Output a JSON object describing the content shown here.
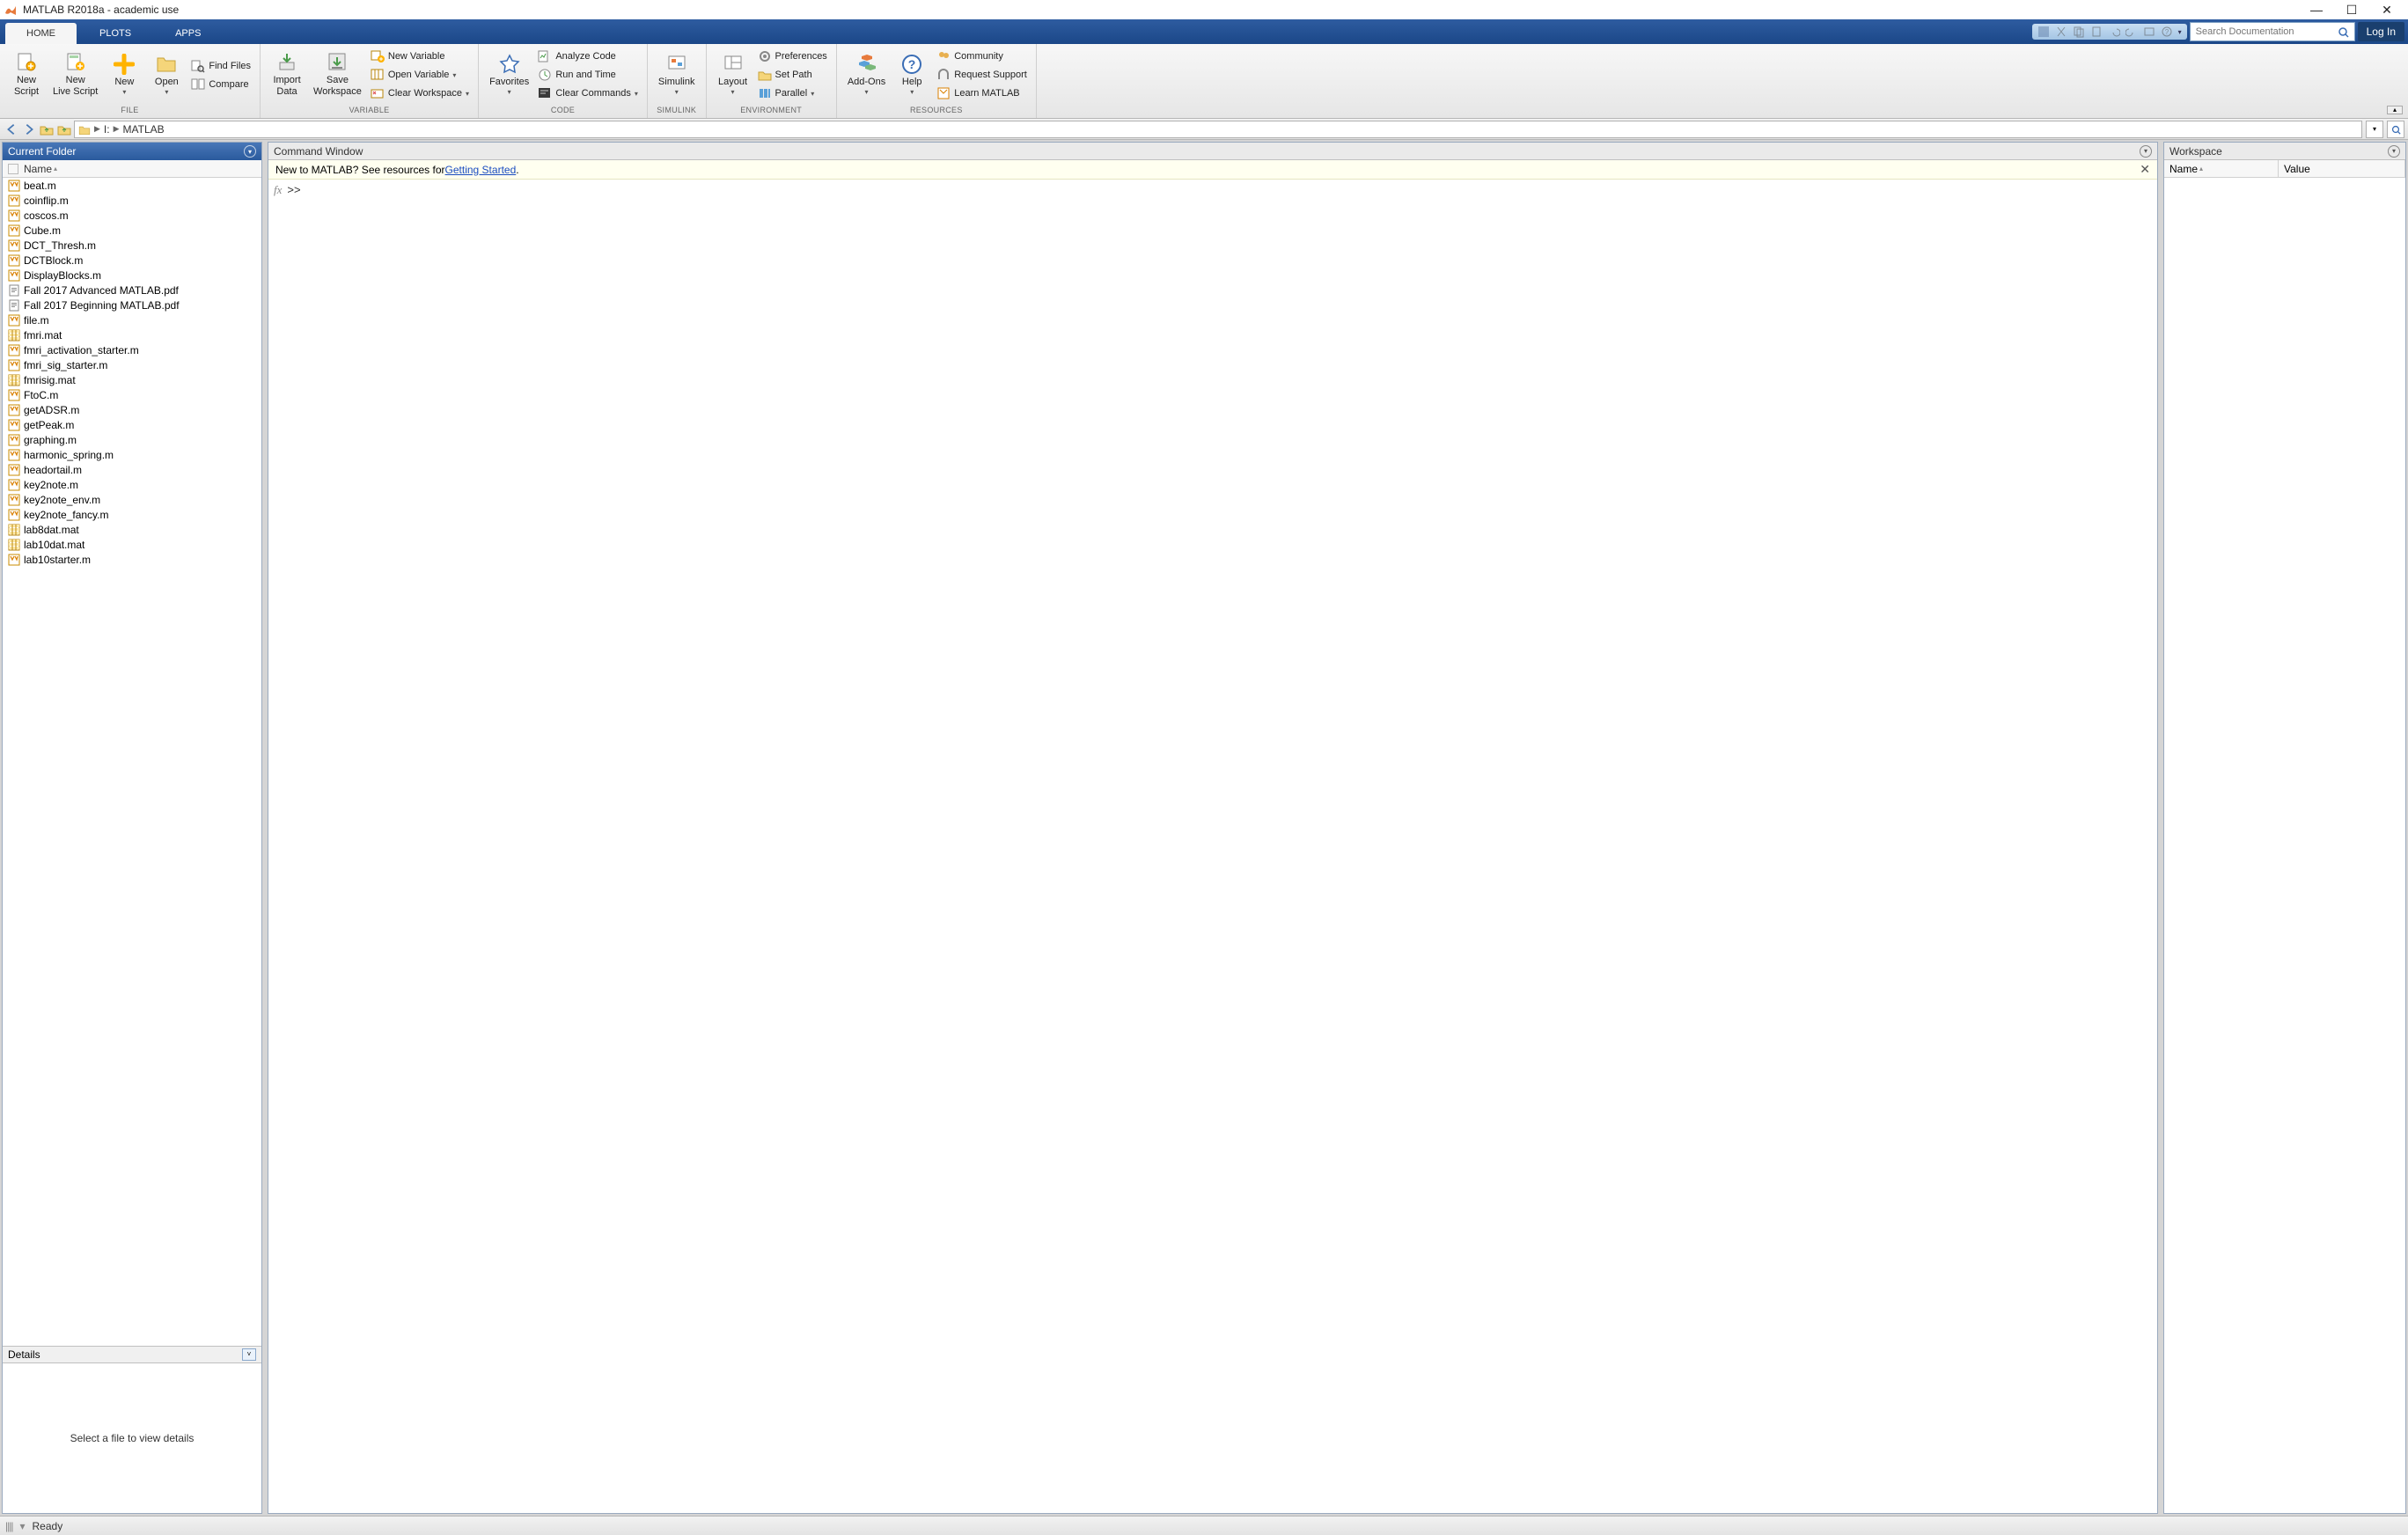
{
  "title": "MATLAB R2018a - academic use",
  "tabs": [
    "HOME",
    "PLOTS",
    "APPS"
  ],
  "active_tab": 0,
  "search_placeholder": "Search Documentation",
  "login_label": "Log In",
  "toolstrip": {
    "file": {
      "label": "FILE",
      "new_script": "New\nScript",
      "new_live_script": "New\nLive Script",
      "new": "New",
      "open": "Open",
      "find_files": "Find Files",
      "compare": "Compare"
    },
    "variable": {
      "label": "VARIABLE",
      "import_data": "Import\nData",
      "save_workspace": "Save\nWorkspace",
      "new_variable": "New Variable",
      "open_variable": "Open Variable",
      "clear_workspace": "Clear Workspace"
    },
    "code": {
      "label": "CODE",
      "favorites": "Favorites",
      "analyze_code": "Analyze Code",
      "run_and_time": "Run and Time",
      "clear_commands": "Clear Commands"
    },
    "simulink": {
      "label": "SIMULINK",
      "simulink": "Simulink"
    },
    "environment": {
      "label": "ENVIRONMENT",
      "layout": "Layout",
      "preferences": "Preferences",
      "set_path": "Set Path",
      "parallel": "Parallel"
    },
    "addons": "Add-Ons",
    "help": "Help",
    "resources": {
      "label": "RESOURCES",
      "community": "Community",
      "request_support": "Request Support",
      "learn_matlab": "Learn MATLAB"
    }
  },
  "address": {
    "drive": "I:",
    "folder": "MATLAB"
  },
  "current_folder": {
    "title": "Current Folder",
    "name_col": "Name",
    "details_label": "Details",
    "details_hint": "Select a file to view details",
    "files": [
      {
        "name": "beat.m",
        "type": "m"
      },
      {
        "name": "coinflip.m",
        "type": "m"
      },
      {
        "name": "coscos.m",
        "type": "m"
      },
      {
        "name": "Cube.m",
        "type": "m"
      },
      {
        "name": "DCT_Thresh.m",
        "type": "m"
      },
      {
        "name": "DCTBlock.m",
        "type": "m"
      },
      {
        "name": "DisplayBlocks.m",
        "type": "m"
      },
      {
        "name": "Fall 2017 Advanced MATLAB.pdf",
        "type": "pdf"
      },
      {
        "name": "Fall 2017 Beginning MATLAB.pdf",
        "type": "pdf"
      },
      {
        "name": "file.m",
        "type": "m"
      },
      {
        "name": "fmri.mat",
        "type": "mat"
      },
      {
        "name": "fmri_activation_starter.m",
        "type": "m"
      },
      {
        "name": "fmri_sig_starter.m",
        "type": "m"
      },
      {
        "name": "fmrisig.mat",
        "type": "mat"
      },
      {
        "name": "FtoC.m",
        "type": "m"
      },
      {
        "name": "getADSR.m",
        "type": "m"
      },
      {
        "name": "getPeak.m",
        "type": "m"
      },
      {
        "name": "graphing.m",
        "type": "m"
      },
      {
        "name": "harmonic_spring.m",
        "type": "m"
      },
      {
        "name": "headortail.m",
        "type": "m"
      },
      {
        "name": "key2note.m",
        "type": "m"
      },
      {
        "name": "key2note_env.m",
        "type": "m"
      },
      {
        "name": "key2note_fancy.m",
        "type": "m"
      },
      {
        "name": "lab8dat.mat",
        "type": "mat"
      },
      {
        "name": "lab10dat.mat",
        "type": "mat"
      },
      {
        "name": "lab10starter.m",
        "type": "m"
      }
    ]
  },
  "command_window": {
    "title": "Command Window",
    "banner_pre": "New to MATLAB? See resources for ",
    "banner_link": "Getting Started",
    "banner_post": ".",
    "fx": "fx",
    "prompt": ">>"
  },
  "workspace": {
    "title": "Workspace",
    "col_name": "Name",
    "col_value": "Value"
  },
  "status": "Ready"
}
